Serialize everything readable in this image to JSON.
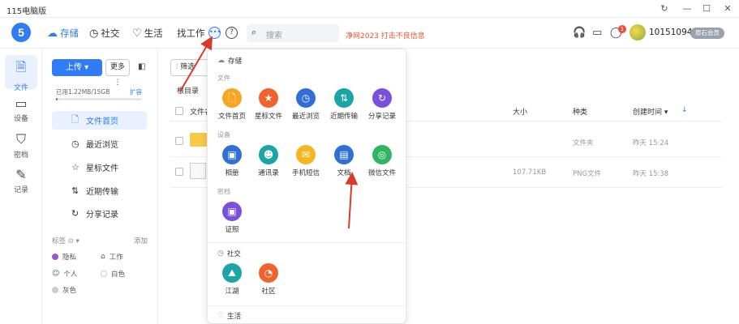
{
  "window": {
    "title": "115电脑版",
    "controls": {
      "refresh": "↻",
      "minimize": "—",
      "maximize": "☐",
      "close": "✕"
    }
  },
  "topnav": {
    "logo": "5",
    "items": [
      {
        "label": "存储",
        "icon": "cloud-icon",
        "glyph": "☁",
        "active": true
      },
      {
        "label": "社交",
        "icon": "clock-icon",
        "glyph": "◷",
        "active": false
      },
      {
        "label": "生活",
        "icon": "heart-icon",
        "glyph": "♡",
        "active": false
      },
      {
        "label": "找工作",
        "icon": "",
        "glyph": "",
        "active": false
      }
    ],
    "more_glyph": "•••",
    "help_glyph": "?",
    "search_placeholder": "搜索",
    "promo": "净网2023 打击不良信息",
    "badge_count": "1",
    "username": "101510941",
    "vip_label": "原石会员"
  },
  "leftnav": [
    {
      "label": "文件",
      "icon": "files-icon",
      "glyph": "🗎",
      "active": true
    },
    {
      "label": "设备",
      "icon": "device-icon",
      "glyph": "▭",
      "active": false
    },
    {
      "label": "密档",
      "icon": "shield-icon",
      "glyph": "⛉",
      "active": false
    },
    {
      "label": "记录",
      "icon": "pen-icon",
      "glyph": "✎",
      "active": false
    }
  ],
  "sidebar": {
    "upload_label": "上传 ▾",
    "more_label": "更多 ⋮",
    "storage_text": "已用1.22MB/15GB",
    "expand_label": "扩容",
    "storage_used_fraction": 0.0001,
    "items": [
      {
        "label": "文件首页",
        "glyph": "🗋",
        "icon": "file-home-icon",
        "active": true
      },
      {
        "label": "最近浏览",
        "glyph": "◷",
        "icon": "recent-icon",
        "active": false
      },
      {
        "label": "星标文件",
        "glyph": "☆",
        "icon": "star-icon",
        "active": false
      },
      {
        "label": "近期传输",
        "glyph": "⇅",
        "icon": "transfer-icon",
        "active": false
      },
      {
        "label": "分享记录",
        "glyph": "↻",
        "icon": "share-icon",
        "active": false
      }
    ],
    "tags_head": "标签 ⊙ ▾",
    "tags_add": "添加",
    "tags": [
      {
        "label": "隐私",
        "color": "#9b59d0"
      },
      {
        "label": "工作",
        "color": "#999999"
      },
      {
        "label": "个人",
        "color": "#999999"
      },
      {
        "label": "白色",
        "color": "#eeeeee"
      },
      {
        "label": "灰色",
        "color": "#cccccc"
      }
    ]
  },
  "main": {
    "filter_label": "筛选",
    "breadcrumb": "根目录",
    "columns": {
      "name": "文件名",
      "size": "大小",
      "type": "种类",
      "created": "创建时间 ▾"
    },
    "rows": [
      {
        "name": "",
        "size": "",
        "type": "文件夹",
        "created": "昨天 15:24",
        "kind": "folder"
      },
      {
        "name": "",
        "size": "107.71KB",
        "type": "PNG文件",
        "created": "昨天 15:38",
        "kind": "image"
      }
    ]
  },
  "popup": {
    "storage_section": "存储",
    "file_sub": "文件",
    "file_apps": [
      {
        "label": "文件首页",
        "color": "#f5a623",
        "glyph": "🗋"
      },
      {
        "label": "星标文件",
        "color": "#f0632e",
        "glyph": "★"
      },
      {
        "label": "最近浏览",
        "color": "#2f6fd6",
        "glyph": "◷"
      },
      {
        "label": "近期传输",
        "color": "#1aa6a6",
        "glyph": "⇅"
      },
      {
        "label": "分享记录",
        "color": "#7b4fe0",
        "glyph": "↻"
      }
    ],
    "device_sub": "设备",
    "device_apps": [
      {
        "label": "相册",
        "color": "#2f6fd6",
        "glyph": "▣"
      },
      {
        "label": "通讯录",
        "color": "#1aa6a6",
        "glyph": "☻"
      },
      {
        "label": "手机短信",
        "color": "#f5b623",
        "glyph": "✉"
      },
      {
        "label": "文档",
        "color": "#2f6fd6",
        "glyph": "▤"
      },
      {
        "label": "微信文件",
        "color": "#2fb562",
        "glyph": "◎"
      }
    ],
    "secret_sub": "密档",
    "secret_apps": [
      {
        "label": "证照",
        "color": "#7b4fe0",
        "glyph": "▣"
      }
    ],
    "social_section": "社交",
    "social_apps": [
      {
        "label": "江湖",
        "color": "#1aa6a6",
        "glyph": "⛰"
      },
      {
        "label": "社区",
        "color": "#f0632e",
        "glyph": "◔"
      }
    ],
    "life_section": "生活"
  }
}
